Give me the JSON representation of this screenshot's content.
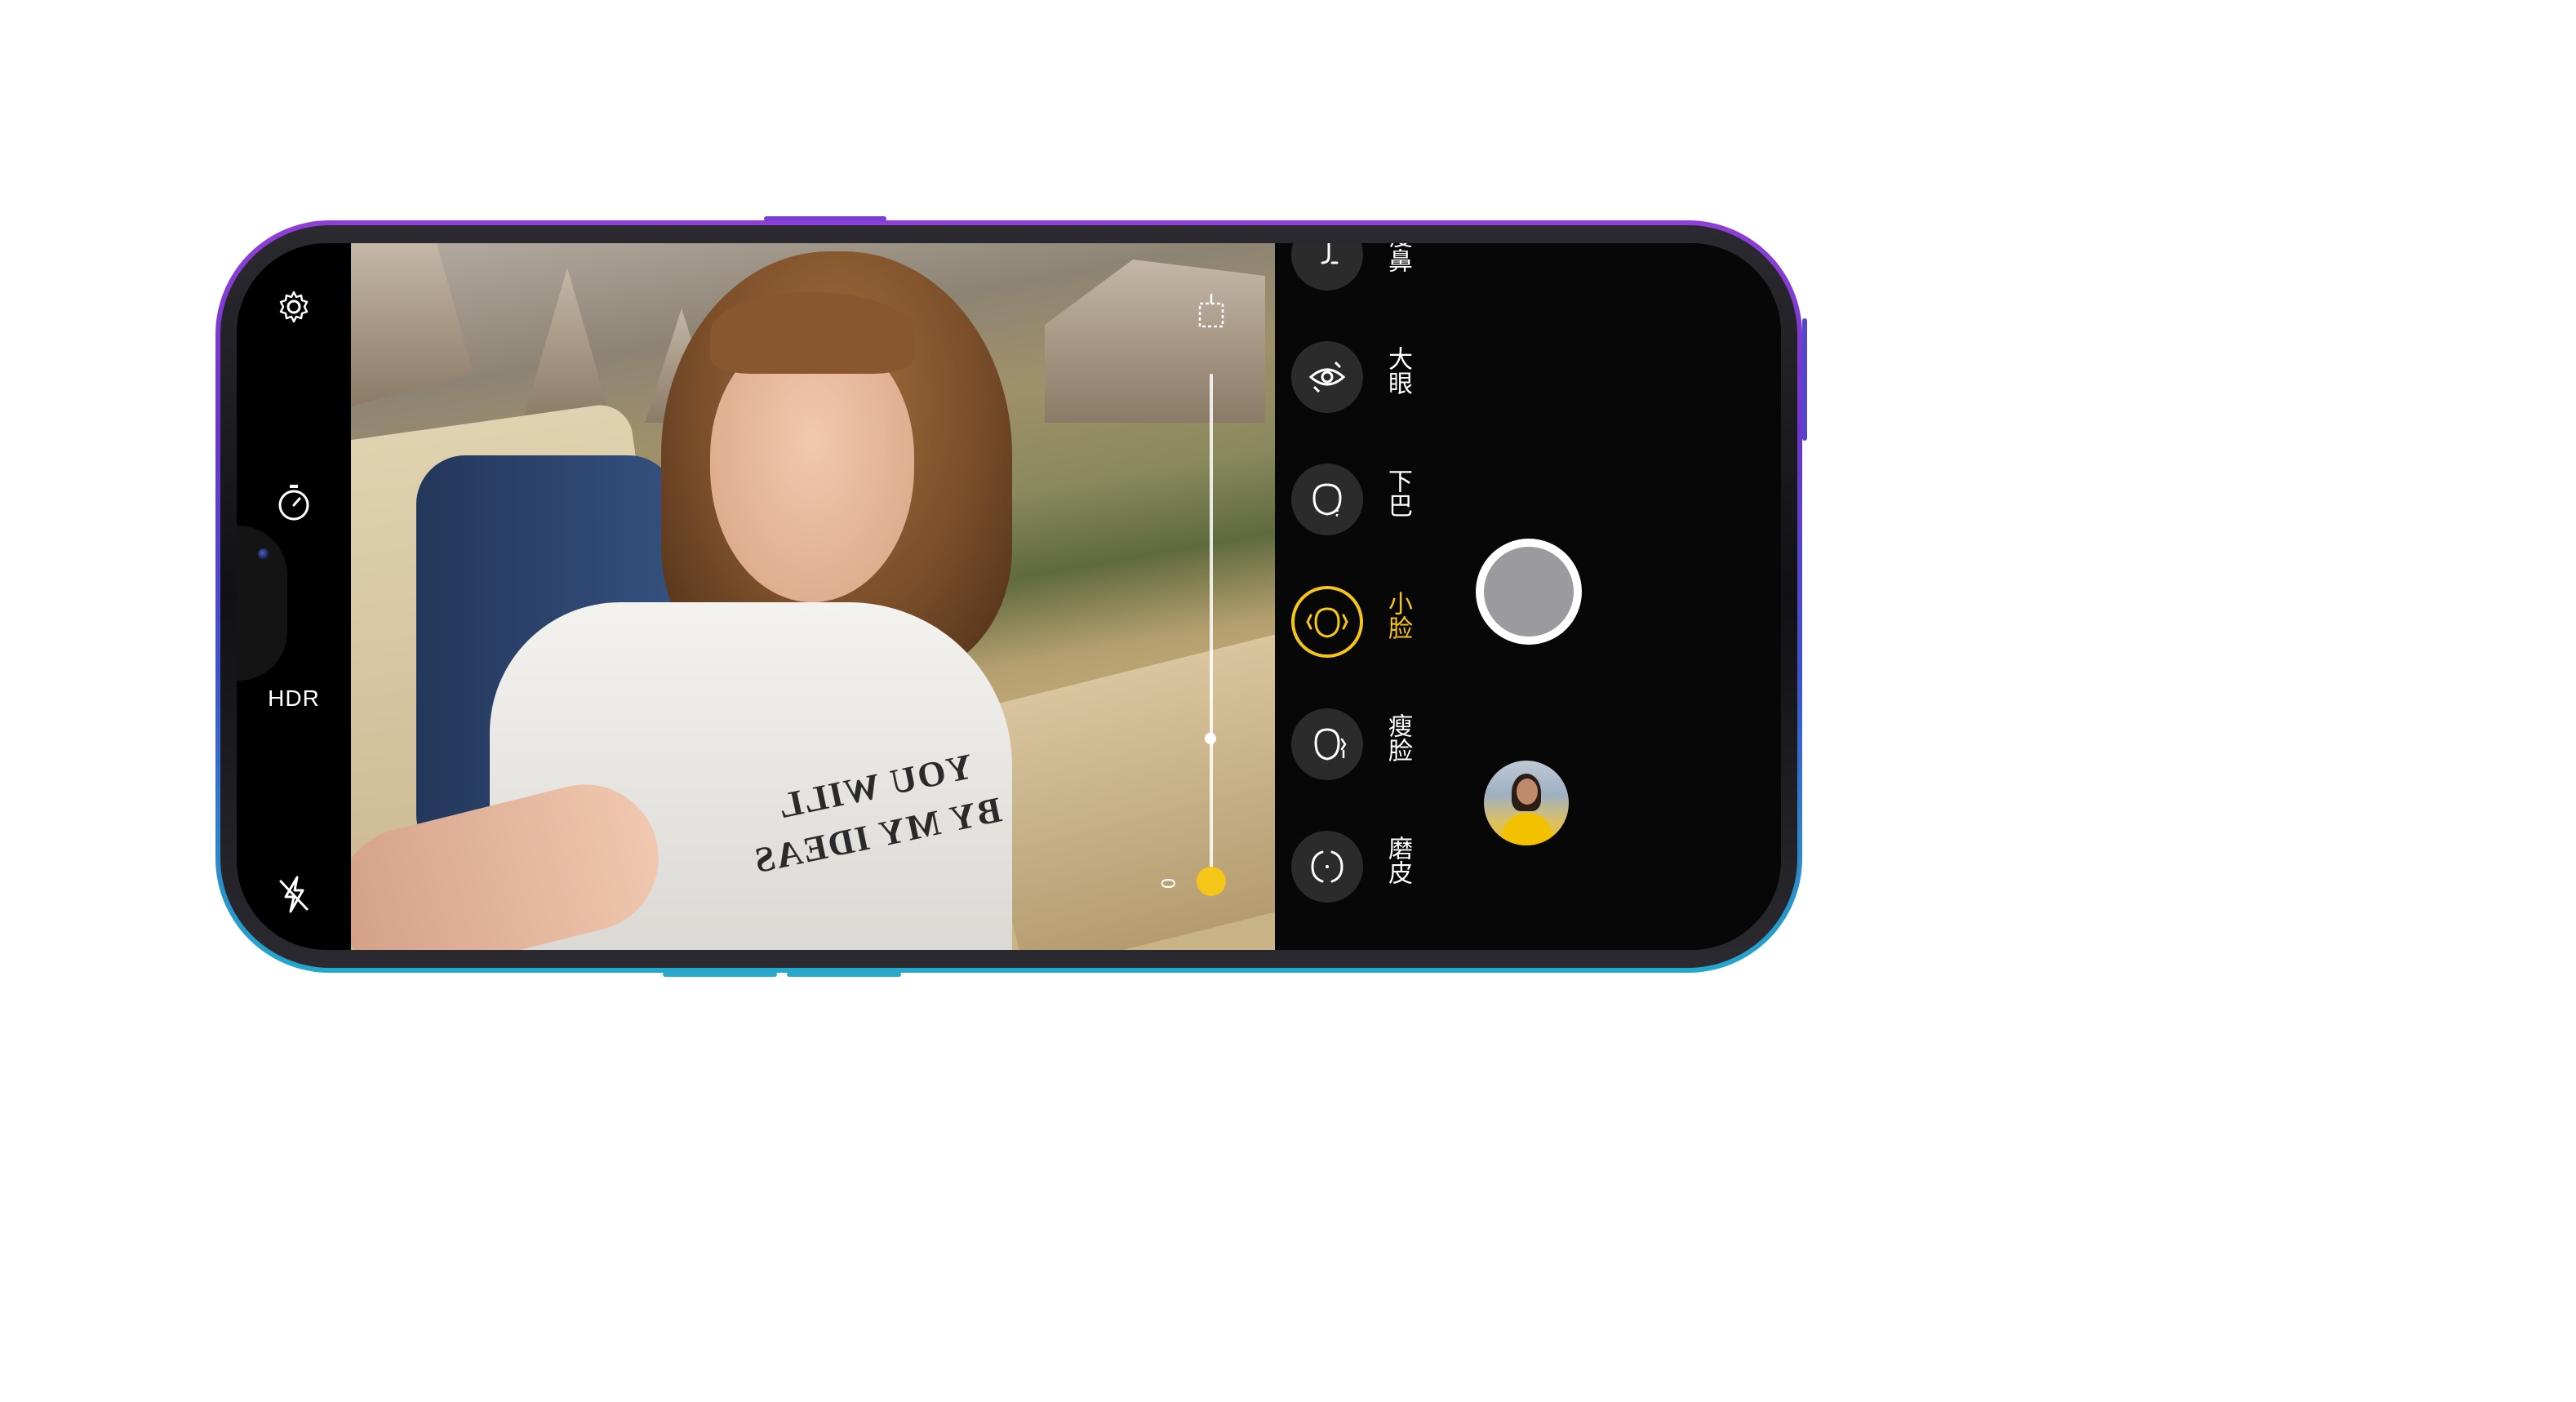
{
  "left_toolbar": {
    "settings_icon": "gear-icon",
    "timer_icon": "timer-icon",
    "hdr_label": "HDR",
    "flash_icon": "flash-off-icon"
  },
  "viewfinder": {
    "shirt_text_line1": "YOU WILL",
    "shirt_text_line2": "BY MY IDEAS",
    "slider_value": "0",
    "slider_level": 0
  },
  "beauty_modes": {
    "items": [
      {
        "label": "瘦鼻",
        "icon": "nose-icon"
      },
      {
        "label": "大眼",
        "icon": "eye-icon"
      },
      {
        "label": "下巴",
        "icon": "chin-icon"
      },
      {
        "label": "小脸",
        "icon": "small-face-icon",
        "active": true
      },
      {
        "label": "瘦脸",
        "icon": "slim-face-icon"
      },
      {
        "label": "磨皮",
        "icon": "smooth-skin-icon"
      }
    ]
  },
  "controls": {
    "shutter": "shutter-button",
    "gallery": "gallery-thumbnail"
  },
  "colors": {
    "accent": "#f5c518",
    "phone_gradient_top": "#8f3fd6",
    "phone_gradient_bottom": "#23a8cc"
  }
}
